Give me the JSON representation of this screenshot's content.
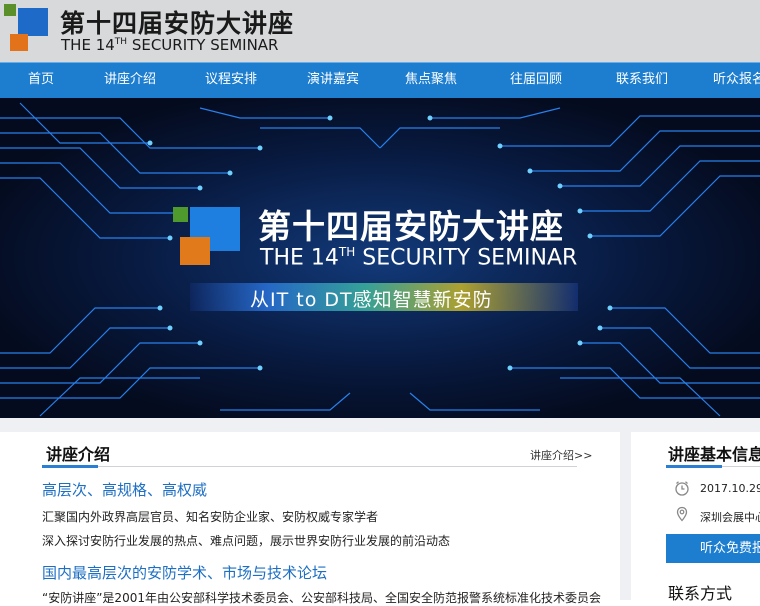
{
  "header": {
    "title_cn": "第十四届安防大讲座",
    "title_en_prefix": "THE 14",
    "title_en_sup": "TH",
    "title_en_suffix": " SECURITY SEMINAR"
  },
  "nav": {
    "items": [
      {
        "label": "首页"
      },
      {
        "label": "讲座介绍"
      },
      {
        "label": "议程安排"
      },
      {
        "label": "演讲嘉宾"
      },
      {
        "label": "焦点聚焦"
      },
      {
        "label": "往届回顾"
      },
      {
        "label": "联系我们"
      },
      {
        "label": "听众报名"
      }
    ]
  },
  "banner": {
    "title_cn": "第十四届安防大讲座",
    "title_en_prefix": "THE 14",
    "title_en_sup": "TH",
    "title_en_suffix": " SECURITY SEMINAR",
    "slogan": "从IT to DT感知智慧新安防"
  },
  "intro": {
    "title": "讲座介绍",
    "more": "讲座介绍>>",
    "heading1": "高层次、高规格、高权威",
    "line1": "汇聚国内外政界高层官员、知名安防企业家、安防权威专家学者",
    "line2": "深入探讨安防行业发展的热点、难点问题，展示世界安防行业发展的前沿动态",
    "heading2": "国内最高层次的安防学术、市场与技术论坛",
    "line3": "“安防讲座”是2001年由公安部科学技术委员会、公安部科技局、全国安全防范报警系统标准化技术委员会"
  },
  "sidebar": {
    "title": "讲座基本信息",
    "date": "2017.10.29",
    "venue": "深圳会展中心",
    "button": "听众免费报名",
    "contact_title": "联系方式"
  }
}
